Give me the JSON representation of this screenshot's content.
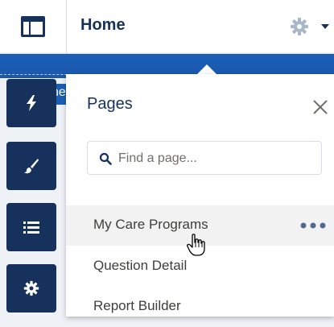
{
  "header": {
    "title": "Home",
    "icons": {
      "app_launcher": "app-launcher-icon",
      "setup": "gear-icon",
      "dropdown": "chevron-down-icon"
    }
  },
  "background": {
    "partial_text": "ne"
  },
  "sidebar_rail": {
    "items": [
      {
        "icon": "lightning-icon"
      },
      {
        "icon": "paint-brush-icon"
      },
      {
        "icon": "list-icon"
      },
      {
        "icon": "gear-icon"
      }
    ]
  },
  "pages_panel": {
    "title": "Pages",
    "search": {
      "placeholder": "Find a page...",
      "value": ""
    },
    "items": [
      {
        "label": "My Care Programs",
        "hovered": true
      },
      {
        "label": "Question Detail",
        "hovered": false
      },
      {
        "label": "Report Builder",
        "hovered": false
      }
    ]
  },
  "colors": {
    "brand_dark": "#16325c",
    "brand_blue": "#1b5fb5",
    "text": "#3e3e3c",
    "muted": "#706e6b",
    "hover": "#f3f2f2"
  }
}
